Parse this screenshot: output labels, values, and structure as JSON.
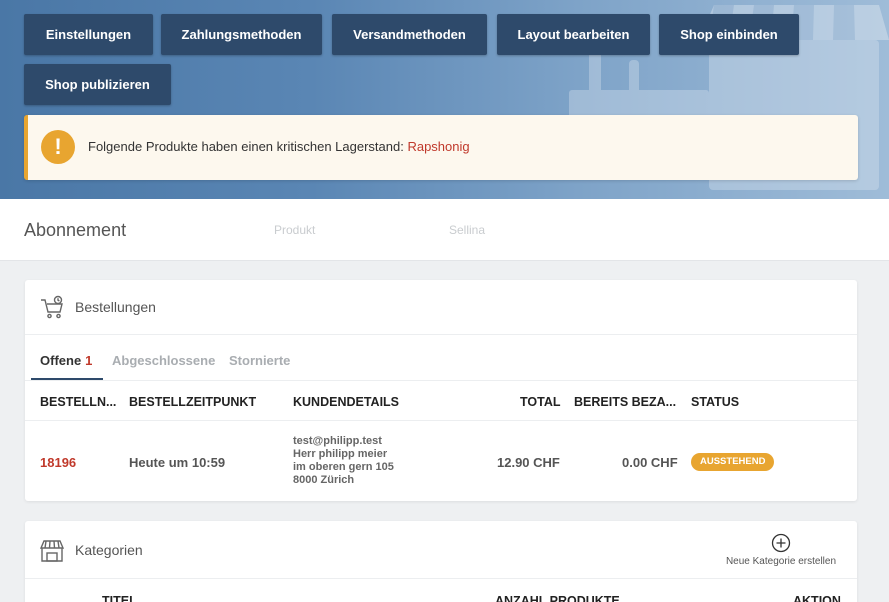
{
  "toolbar": {
    "buttons": [
      "Einstellungen",
      "Zahlungsmethoden",
      "Versandmethoden",
      "Layout bearbeiten",
      "Shop einbinden",
      "Shop publizieren"
    ]
  },
  "alert": {
    "icon": "!",
    "text": "Folgende Produkte haben einen kritischen Lagerstand: ",
    "product_link": "Rapshonig"
  },
  "subnav": {
    "title": "Abonnement",
    "items": [
      "Produkt",
      "Sellina"
    ]
  },
  "orders": {
    "title": "Bestellungen",
    "icon": "cart-icon",
    "tabs": [
      {
        "label": "Offene",
        "count": "1",
        "active": true
      },
      {
        "label": "Abgeschlossene"
      },
      {
        "label": "Stornierte"
      }
    ],
    "columns": [
      "BESTELLN...",
      "BESTELLZEITPUNKT",
      "KUNDENDETAILS",
      "TOTAL",
      "BEREITS BEZA...",
      "STATUS"
    ],
    "rows": [
      {
        "order_number": "18196",
        "time": "Heute um 10:59",
        "customer": [
          "test@philipp.test",
          "Herr philipp meier",
          "im oberen gern 105",
          "8000 Zürich"
        ],
        "total": "12.90 CHF",
        "paid": "0.00 CHF",
        "status": "AUSSTEHEND"
      }
    ]
  },
  "categories": {
    "title": "Kategorien",
    "icon": "store-icon",
    "add_label": "Neue Kategorie erstellen",
    "columns": [
      "TITEL",
      "ANZAHL PRODUKTE",
      "AKTION"
    ]
  },
  "colors": {
    "accent_dark": "#2e4a6b",
    "warning": "#e8a530",
    "link_red": "#c0392b"
  }
}
